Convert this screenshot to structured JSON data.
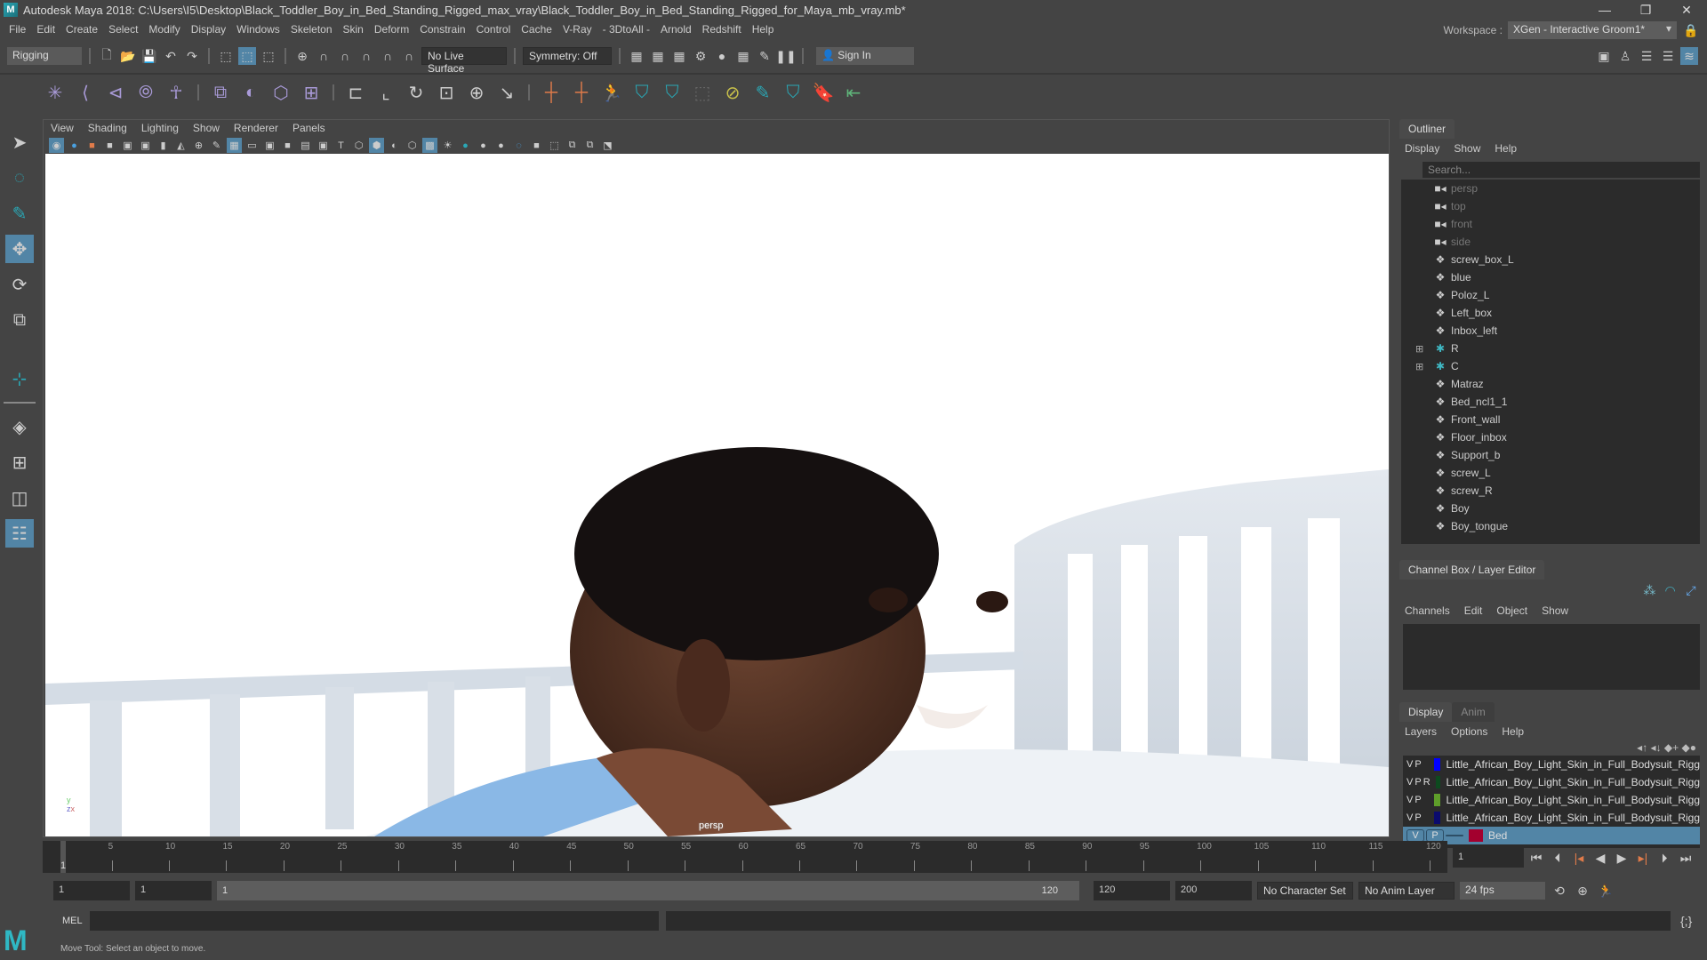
{
  "window": {
    "title": "Autodesk Maya 2018: C:\\Users\\I5\\Desktop\\Black_Toddler_Boy_in_Bed_Standing_Rigged_max_vray\\Black_Toddler_Boy_in_Bed_Standing_Rigged_for_Maya_mb_vray.mb*",
    "logo": "M",
    "controls": [
      "—",
      "❐",
      "✕"
    ]
  },
  "menubar": [
    "File",
    "Edit",
    "Create",
    "Select",
    "Modify",
    "Display",
    "Windows",
    "Skeleton",
    "Skin",
    "Deform",
    "Constrain",
    "Control",
    "Cache",
    "V-Ray",
    "- 3DtoAll -",
    "Arnold",
    "Redshift",
    "Help"
  ],
  "workspace": {
    "label": "Workspace :",
    "value": "XGen - Interactive Groom1*"
  },
  "statusline": {
    "menuset": "Rigging",
    "live_surface": "No Live Surface",
    "symmetry": "Symmetry: Off",
    "sign_in": "Sign In"
  },
  "viewport": {
    "menu": [
      "View",
      "Shading",
      "Lighting",
      "Show",
      "Renderer",
      "Panels"
    ],
    "camera_label": "persp",
    "axis": {
      "y": "y",
      "z": "z",
      "x": "x"
    }
  },
  "outliner": {
    "tab": "Outliner",
    "menu": [
      "Display",
      "Show",
      "Help"
    ],
    "search_placeholder": "Search...",
    "items": [
      {
        "name": "persp",
        "type": "camera"
      },
      {
        "name": "top",
        "type": "camera"
      },
      {
        "name": "front",
        "type": "camera"
      },
      {
        "name": "side",
        "type": "camera"
      },
      {
        "name": "screw_box_L",
        "type": "mesh"
      },
      {
        "name": "blue",
        "type": "mesh"
      },
      {
        "name": "Poloz_L",
        "type": "mesh"
      },
      {
        "name": "Left_box",
        "type": "mesh"
      },
      {
        "name": "Inbox_left",
        "type": "mesh"
      },
      {
        "name": "R",
        "type": "joint",
        "expandable": true
      },
      {
        "name": "C",
        "type": "joint",
        "expandable": true
      },
      {
        "name": "Matraz",
        "type": "mesh"
      },
      {
        "name": "Bed_ncl1_1",
        "type": "mesh"
      },
      {
        "name": "Front_wall",
        "type": "mesh"
      },
      {
        "name": "Floor_inbox",
        "type": "mesh"
      },
      {
        "name": "Support_b",
        "type": "mesh"
      },
      {
        "name": "screw_L",
        "type": "mesh"
      },
      {
        "name": "screw_R",
        "type": "mesh"
      },
      {
        "name": "Boy",
        "type": "mesh"
      },
      {
        "name": "Boy_tongue",
        "type": "mesh"
      }
    ]
  },
  "channelbox": {
    "tab": "Channel Box / Layer Editor",
    "menu": [
      "Channels",
      "Edit",
      "Object",
      "Show"
    ]
  },
  "layers": {
    "tabs": [
      "Display",
      "Anim"
    ],
    "menu": [
      "Layers",
      "Options",
      "Help"
    ],
    "rows": [
      {
        "v": "V",
        "p": "P",
        "r": "",
        "color": "#0000ff",
        "name": "Little_African_Boy_Light_Skin_in_Full_Bodysuit_Rigg"
      },
      {
        "v": "V",
        "p": "P",
        "r": "R",
        "color": "#0d4a1f",
        "name": "Little_African_Boy_Light_Skin_in_Full_Bodysuit_Rigg"
      },
      {
        "v": "V",
        "p": "P",
        "r": "",
        "color": "#5f9e2a",
        "name": "Little_African_Boy_Light_Skin_in_Full_Bodysuit_Rigg"
      },
      {
        "v": "V",
        "p": "P",
        "r": "",
        "color": "#0b0b6e",
        "name": "Little_African_Boy_Light_Skin_in_Full_Bodysuit_Rigg"
      },
      {
        "v": "V",
        "p": "P",
        "r": "",
        "color": "#a3002e",
        "name": "Bed",
        "selected": true
      }
    ]
  },
  "timeline": {
    "ticks": [
      "5",
      "10",
      "15",
      "20",
      "25",
      "30",
      "35",
      "40",
      "45",
      "50",
      "55",
      "60",
      "65",
      "70",
      "75",
      "80",
      "85",
      "90",
      "95",
      "100",
      "105",
      "110",
      "115",
      "120"
    ],
    "current_frame_marker": "1",
    "current_frame": "1"
  },
  "range": {
    "start": "1",
    "playback_start": "1",
    "slider_start": "1",
    "slider_end": "120",
    "playback_end": "120",
    "end": "200",
    "character_set": "No Character Set",
    "anim_layer": "No Anim Layer",
    "fps": "24 fps"
  },
  "cmdline": {
    "label": "MEL"
  },
  "helpline": "Move Tool: Select an object to move."
}
